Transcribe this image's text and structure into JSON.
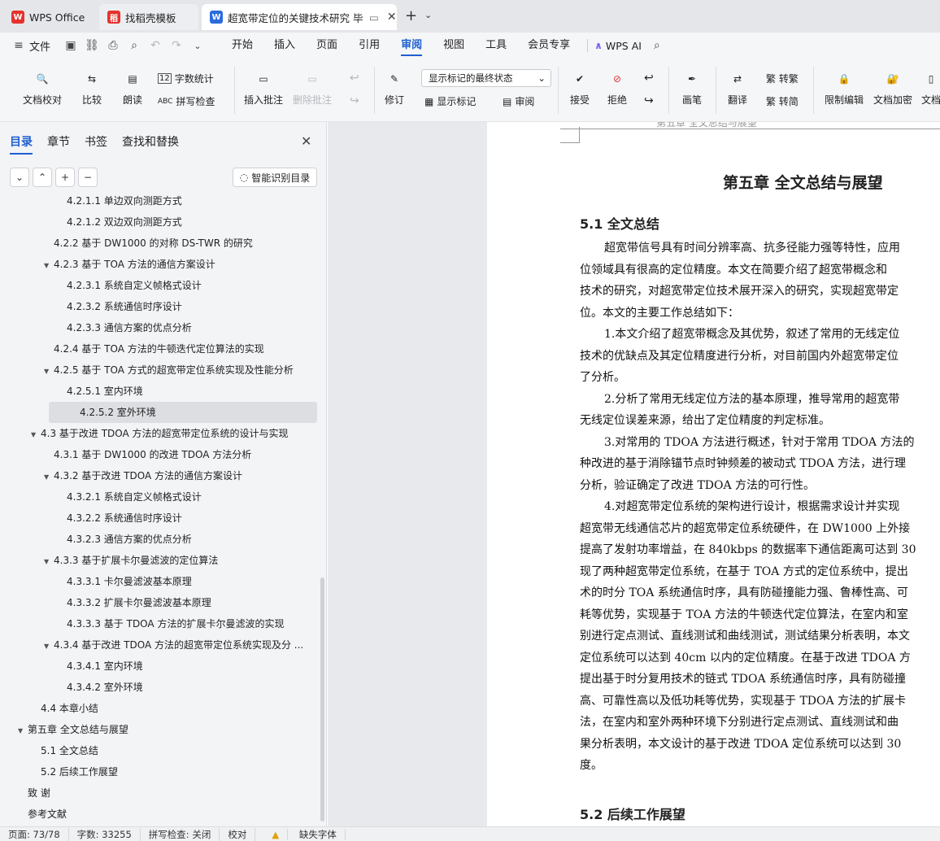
{
  "tabs": [
    {
      "label": "WPS Office",
      "icon": "wps-logo-icon",
      "color": "#e5322d"
    },
    {
      "label": "找稻壳模板",
      "icon": "daoke-icon",
      "color": "#e5322d"
    },
    {
      "label": "超宽带定位的关键技术研究 毕",
      "icon": "word-doc-icon",
      "color": "#2b6cde"
    }
  ],
  "menu": {
    "file": "文件",
    "items": [
      "开始",
      "插入",
      "页面",
      "引用",
      "审阅",
      "视图",
      "工具",
      "会员专享"
    ],
    "active": "审阅",
    "ai": "WPS AI"
  },
  "ribbon": {
    "proofread": "文档校对",
    "compare": "比较",
    "read": "朗读",
    "wordcount": "字数统计",
    "spellcheck": "拼写检查",
    "insert_comment": "插入批注",
    "delete_comment": "删除批注",
    "revise": "修订",
    "markup_select": "显示标记的最终状态",
    "show_markup": "显示标记",
    "review": "审阅",
    "accept": "接受",
    "reject": "拒绝",
    "pen": "画笔",
    "translate": "翻译",
    "to_traditional": "繁 转繁",
    "to_simplified": "繁 转简",
    "restrict_edit": "限制编辑",
    "encrypt": "文档加密",
    "more": "文档"
  },
  "sidebar": {
    "tabs": [
      "目录",
      "章节",
      "书签",
      "查找和替换"
    ],
    "active_tab": "目录",
    "smart_toc": "智能识别目录",
    "toc": [
      {
        "t": "4.2.1.1 单边双向测距方式",
        "l": 3,
        "a": ""
      },
      {
        "t": "4.2.1.2 双边双向测距方式",
        "l": 3,
        "a": ""
      },
      {
        "t": "4.2.2 基于 DW1000 的对称 DS-TWR 的研究",
        "l": 2,
        "a": ""
      },
      {
        "t": "4.2.3 基于 TOA 方法的通信方案设计",
        "l": 2,
        "a": "▼"
      },
      {
        "t": "4.2.3.1 系统自定义帧格式设计",
        "l": 3,
        "a": ""
      },
      {
        "t": "4.2.3.2 系统通信时序设计",
        "l": 3,
        "a": ""
      },
      {
        "t": "4.2.3.3 通信方案的优点分析",
        "l": 3,
        "a": ""
      },
      {
        "t": "4.2.4 基于 TOA 方法的牛顿迭代定位算法的实现",
        "l": 2,
        "a": ""
      },
      {
        "t": "4.2.5 基于 TOA 方式的超宽带定位系统实现及性能分析",
        "l": 2,
        "a": "▼"
      },
      {
        "t": "4.2.5.1 室内环境",
        "l": 3,
        "a": ""
      },
      {
        "t": "4.2.5.2 室外环境",
        "l": 3,
        "a": "",
        "sel": true
      },
      {
        "t": "4.3 基于改进 TDOA 方法的超宽带定位系统的设计与实现",
        "l": 1,
        "a": "▼"
      },
      {
        "t": "4.3.1 基于 DW1000 的改进 TDOA 方法分析",
        "l": 2,
        "a": ""
      },
      {
        "t": "4.3.2 基于改进 TDOA 方法的通信方案设计",
        "l": 2,
        "a": "▼"
      },
      {
        "t": "4.3.2.1 系统自定义帧格式设计",
        "l": 3,
        "a": ""
      },
      {
        "t": "4.3.2.2 系统通信时序设计",
        "l": 3,
        "a": ""
      },
      {
        "t": "4.3.2.3 通信方案的优点分析",
        "l": 3,
        "a": ""
      },
      {
        "t": "4.3.3 基于扩展卡尔曼滤波的定位算法",
        "l": 2,
        "a": "▼"
      },
      {
        "t": "4.3.3.1 卡尔曼滤波基本原理",
        "l": 3,
        "a": ""
      },
      {
        "t": "4.3.3.2 扩展卡尔曼滤波基本原理",
        "l": 3,
        "a": ""
      },
      {
        "t": "4.3.3.3 基于 TDOA 方法的扩展卡尔曼滤波的实现",
        "l": 3,
        "a": ""
      },
      {
        "t": "4.3.4 基于改进 TDOA 方法的超宽带定位系统实现及分 ...",
        "l": 2,
        "a": "▼"
      },
      {
        "t": "4.3.4.1 室内环境",
        "l": 3,
        "a": ""
      },
      {
        "t": "4.3.4.2 室外环境",
        "l": 3,
        "a": ""
      },
      {
        "t": "4.4 本章小结",
        "l": 1,
        "a": ""
      },
      {
        "t": "第五章 全文总结与展望",
        "l": 0,
        "a": "▼"
      },
      {
        "t": "5.1 全文总结",
        "l": 1,
        "a": ""
      },
      {
        "t": "5.2 后续工作展望",
        "l": 1,
        "a": ""
      },
      {
        "t": "致 谢",
        "l": 0,
        "a": ""
      },
      {
        "t": "参考文献",
        "l": 0,
        "a": ""
      }
    ]
  },
  "doc": {
    "header": "第五章 全文总结与展望",
    "title": "第五章 全文总结与展望",
    "s1": "5.1 全文总结",
    "s2": "5.2 后续工作展望",
    "lines": [
      " 超宽带信号具有时间分辨率高、抗多径能力强等特性，应用",
      "位领域具有很高的定位精度。本文在简要介绍了超宽带概念和",
      "技术的研究，对超宽带定位技术展开深入的研究，实现超宽带定",
      "位。本文的主要工作总结如下：",
      " 1.本文介绍了超宽带概念及其优势，叙述了常用的无线定位",
      "技术的优缺点及其定位精度进行分析，对目前国内外超宽带定位",
      "了分析。",
      " 2.分析了常用无线定位方法的基本原理，推导常用的超宽带",
      "无线定位误差来源，给出了定位精度的判定标准。",
      " 3.对常用的 TDOA 方法进行概述，针对于常用 TDOA 方法的",
      "种改进的基于消除锚节点时钟频差的被动式 TDOA 方法，进行理",
      "分析，验证确定了改进 TDOA 方法的可行性。",
      " 4.对超宽带定位系统的架构进行设计，根据需求设计并实现",
      "超宽带无线通信芯片的超宽带定位系统硬件，在 DW1000 上外接",
      "提高了发射功率增益，在 840kbps 的数据率下通信距离可达到 30",
      "现了两种超宽带定位系统，在基于 TOA 方式的定位系统中，提出",
      "术的时分 TOA 系统通信时序，具有防碰撞能力强、鲁棒性高、可",
      "耗等优势，实现基于 TOA 方法的牛顿迭代定位算法，在室内和室",
      "别进行定点测试、直线测试和曲线测试，测试结果分析表明，本文",
      "定位系统可以达到 40cm 以内的定位精度。在基于改进 TDOA 方",
      "提出基于时分复用技术的链式 TDOA 系统通信时序，具有防碰撞",
      "高、可靠性高以及低功耗等优势，实现基于 TDOA 方法的扩展卡",
      "法，在室内和室外两种环境下分别进行定点测试、直线测试和曲",
      "果分析表明，本文设计的基于改进 TDOA 定位系统可以达到 30",
      "度。"
    ]
  },
  "status": {
    "page": "页面: 73/78",
    "words": "字数: 33255",
    "spell": "拼写检查: 关闭",
    "proof": "校对",
    "font": "缺失字体"
  }
}
